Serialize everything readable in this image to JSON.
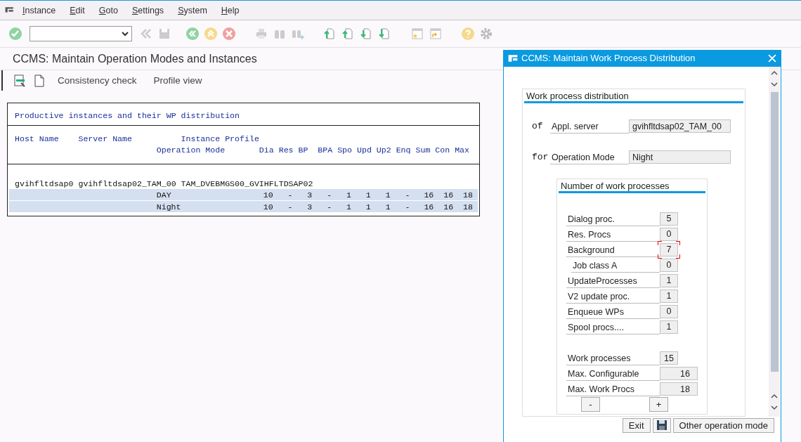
{
  "menu": [
    {
      "label": "Instance"
    },
    {
      "label": "Edit"
    },
    {
      "label": "Goto"
    },
    {
      "label": "Settings"
    },
    {
      "label": "System"
    },
    {
      "label": "Help"
    }
  ],
  "page_title": "CCMS: Maintain Operation Modes and Instances",
  "app_toolbar": [
    {
      "label": "Consistency check"
    },
    {
      "label": "Profile view"
    }
  ],
  "table": {
    "title": "Productive instances and their WP distribution",
    "headers": {
      "host": "Host Name",
      "server": "Server Name",
      "profile": "Instance Profile",
      "mode": "Operation Mode",
      "counts": [
        "Dia",
        "Res",
        "BP",
        "BPA",
        "Spo",
        "Upd",
        "Up2",
        "Enq",
        "Sum",
        "Con",
        "Max"
      ]
    },
    "rows": [
      {
        "host": "gvihfltdsap0",
        "server": "gvihfltdsap02_TAM_00",
        "profile": "TAM_DVEBMGS00_GVIHFLTDSAP02",
        "modes": [
          {
            "mode": "DAY",
            "values": [
              "10",
              "-",
              "3",
              "-",
              "1",
              "1",
              "1",
              "-",
              "16",
              "16",
              "18"
            ]
          },
          {
            "mode": "Night",
            "values": [
              "10",
              "-",
              "3",
              "-",
              "1",
              "1",
              "1",
              "-",
              "16",
              "16",
              "18"
            ]
          }
        ]
      }
    ]
  },
  "dialog": {
    "title": "CCMS: Maintain Work Process Distribution",
    "section": "Work process distribution",
    "fields": [
      {
        "prefix": "of",
        "label": "Appl. server",
        "value": "gvihfltdsap02_TAM_00"
      },
      {
        "prefix": "for",
        "label": "Operation Mode",
        "value": "Night"
      }
    ],
    "subsection": "Number of work processes",
    "processes": [
      {
        "label": "Dialog proc.",
        "value": "5",
        "kind": "main",
        "focused": false
      },
      {
        "label": "Res. Procs",
        "value": "0",
        "kind": "main",
        "focused": false
      },
      {
        "label": "Background",
        "value": "7",
        "kind": "main",
        "focused": true
      },
      {
        "label": "Job class A",
        "value": "0",
        "kind": "sub",
        "focused": false
      },
      {
        "label": "UpdateProcesses",
        "value": "1",
        "kind": "main",
        "focused": false
      },
      {
        "label": "V2 update proc.",
        "value": "1",
        "kind": "main",
        "focused": false
      },
      {
        "label": "Enqueue WPs",
        "value": "0",
        "kind": "main",
        "focused": false
      },
      {
        "label": "Spool procs....",
        "value": "1",
        "kind": "main",
        "focused": false
      }
    ],
    "totals": [
      {
        "label": "Work processes",
        "value": "15",
        "kind": "short"
      },
      {
        "label": "Max. Configurable",
        "value": "16",
        "kind": "wide"
      },
      {
        "label": "Max. Work Procs",
        "value": "18",
        "kind": "wide"
      }
    ],
    "steppers": [
      "-",
      "+"
    ],
    "buttons": [
      {
        "label": "Exit",
        "kind": "text"
      },
      {
        "kind": "save"
      },
      {
        "label": "Other operation mode",
        "kind": "text"
      }
    ]
  }
}
